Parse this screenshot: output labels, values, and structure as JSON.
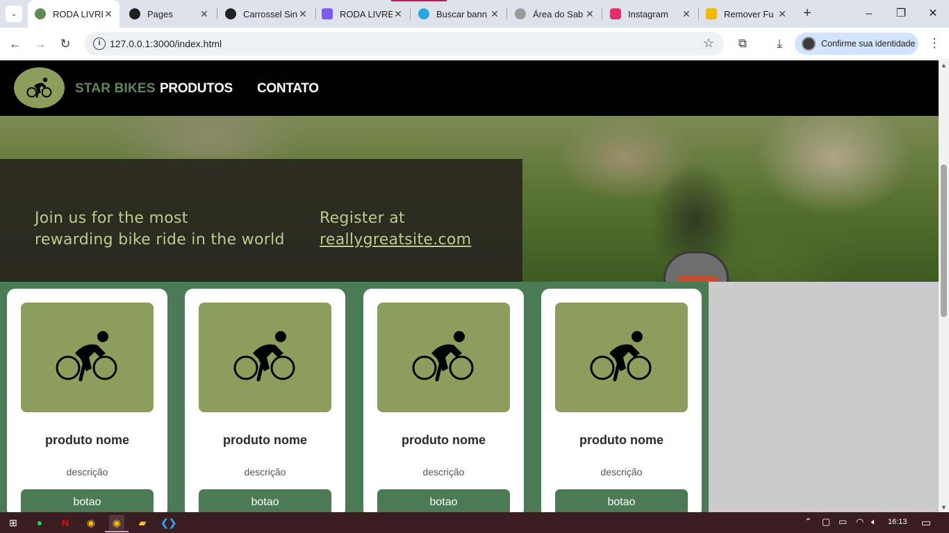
{
  "browser": {
    "tabs": [
      {
        "title": "RODA LIVRE",
        "favicon_color": "#5f8a55",
        "active": true
      },
      {
        "title": "Pages",
        "favicon_color": "#1f1f1f",
        "active": false
      },
      {
        "title": "Carrossel Sin",
        "favicon_color": "#222222",
        "active": false
      },
      {
        "title": "RODA LIVRE",
        "favicon_color": "#7a5cf0",
        "active": false
      },
      {
        "title": "Buscar bann",
        "favicon_color": "#2aa7e0",
        "active": false
      },
      {
        "title": "Área do Sab",
        "favicon_color": "#9a9a9a",
        "active": false
      },
      {
        "title": "Instagram",
        "favicon_color": "#e1306c",
        "active": false
      },
      {
        "title": "Remover Fu",
        "favicon_color": "#f2b705",
        "active": false
      }
    ],
    "url": "127.0.0.1:3000/index.html",
    "profile_label": "Confirme sua identidade"
  },
  "site": {
    "brand": "STAR BIKES",
    "nav": [
      "PRODUTOS",
      "CONTATO"
    ],
    "hero": {
      "tagline_line1": "Join us for the most",
      "tagline_line2": "rewarding bike ride in the world",
      "register_line1": "Register at",
      "register_link": "reallygreatsite.com"
    },
    "products": [
      {
        "name": "produto nome",
        "description": "descrição",
        "button": "botao"
      },
      {
        "name": "produto nome",
        "description": "descrição",
        "button": "botao"
      },
      {
        "name": "produto nome",
        "description": "descrição",
        "button": "botao"
      },
      {
        "name": "produto nome",
        "description": "descrição",
        "button": "botao"
      }
    ]
  },
  "colors": {
    "header_bg": "#000000",
    "accent_green": "#4a7b55",
    "olive": "#8b9e5c",
    "brand_green": "#5f8a55",
    "hero_text": "#bfcb8e"
  },
  "taskbar": {
    "apps": [
      "windows-start",
      "spotify",
      "netflix",
      "chrome",
      "chrome-active",
      "file-explorer",
      "vscode"
    ],
    "clock": "16:13"
  }
}
